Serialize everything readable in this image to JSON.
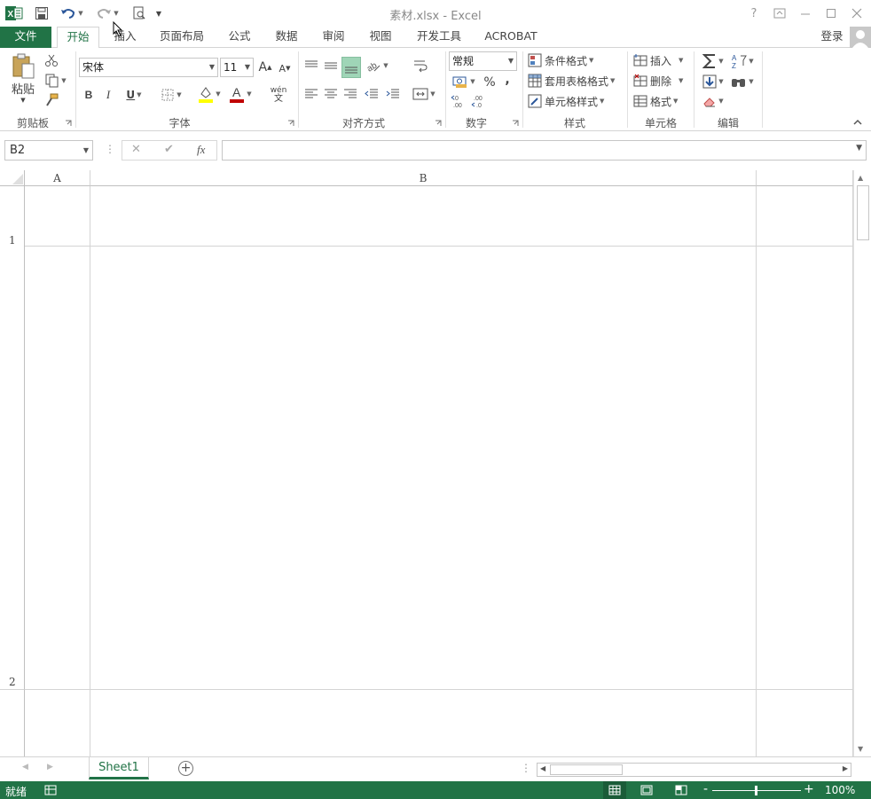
{
  "titlebar": {
    "title": "素材.xlsx - Excel",
    "help": "?",
    "icons": [
      "excel-logo-icon",
      "save-icon",
      "undo-icon",
      "redo-icon",
      "print-preview-icon",
      "customize-qat-icon"
    ]
  },
  "tabs": {
    "file": "文件",
    "items": [
      "开始",
      "插入",
      "页面布局",
      "公式",
      "数据",
      "审阅",
      "视图",
      "开发工具",
      "ACROBAT"
    ],
    "login": "登录"
  },
  "ribbon": {
    "clipboard": {
      "label": "剪贴板",
      "paste": "粘贴"
    },
    "font": {
      "label": "字体",
      "name": "宋体",
      "size": "11",
      "bold": "B",
      "italic": "I",
      "underline": "U",
      "grow": "A",
      "shrink": "A",
      "color_letter": "A",
      "phonetic_top": "wén",
      "phonetic_bottom": "文"
    },
    "alignment": {
      "label": "对齐方式"
    },
    "number": {
      "label": "数字",
      "format": "常规",
      "percent": "%",
      "comma": ",",
      "inc_decimal": "←.0\n.00",
      "dec_decimal": ".00\n→.0"
    },
    "styles": {
      "label": "样式",
      "conditional": "条件格式",
      "table": "套用表格格式",
      "cell_styles": "单元格样式"
    },
    "cells": {
      "label": "单元格",
      "insert": "插入",
      "delete": "删除",
      "format": "格式"
    },
    "editing": {
      "label": "编辑"
    }
  },
  "formula_bar": {
    "name_box": "B2",
    "cancel": "✕",
    "enter": "✔",
    "fx": "fx",
    "value": ""
  },
  "grid": {
    "columns": [
      "A",
      "B"
    ],
    "rows": [
      "1",
      "2"
    ]
  },
  "sheets": {
    "items": [
      "Sheet1"
    ],
    "add": "+"
  },
  "status": {
    "ready": "就绪",
    "zoom": "100%",
    "minus": "-",
    "plus": "+"
  },
  "colors": {
    "accent": "#217346",
    "fill_highlight": "#FFFF00",
    "font_color": "#C00000"
  }
}
